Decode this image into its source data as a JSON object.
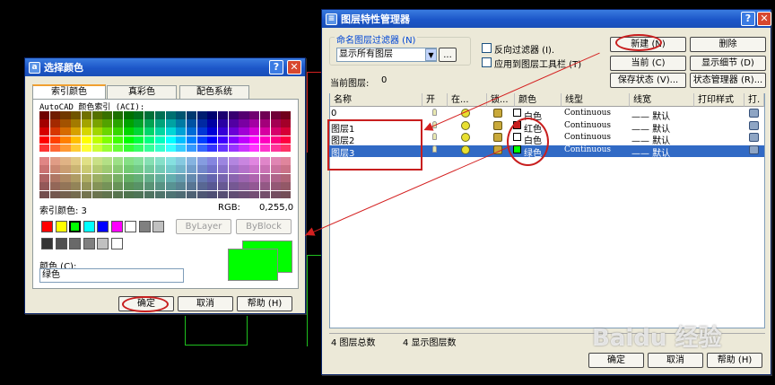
{
  "select_color": {
    "title": "选择颜色",
    "tabs": [
      "索引颜色",
      "真彩色",
      "配色系统"
    ],
    "aci_label": "AutoCAD 颜色索引 (ACI):",
    "index_label": "索引颜色: 3",
    "rgb_label": "RGB:",
    "rgb_value": "0,255,0",
    "bylayer": "ByLayer",
    "byblock": "ByBlock",
    "color_label": "颜色 (C):",
    "color_value": "绿色",
    "ok": "确定",
    "cancel": "取消",
    "help": "帮助 (H)",
    "preview_color": "#00ff00",
    "std_colors": [
      "#ff0000",
      "#ffff00",
      "#00ff00",
      "#00ffff",
      "#0000ff",
      "#ff00ff",
      "#ffffff",
      "#808080",
      "#c0c0c0"
    ],
    "gray_colors": [
      "#333333",
      "#505050",
      "#696969",
      "#808080",
      "#c0c0c0",
      "#ffffff"
    ]
  },
  "layer_manager": {
    "title": "图层特性管理器",
    "filter_label": "命名图层过滤器 (N)",
    "filter_value": "显示所有图层",
    "filter_btn": "...",
    "invert_filter": "反向过滤器 (I).",
    "apply_toolbar": "应用到图层工具栏 (T)",
    "current_layer_label": "当前图层:",
    "current_layer_value": "0",
    "buttons": {
      "new": "新建 (N)",
      "delete": "删除",
      "current": "当前 (C)",
      "details": "显示细节 (D)",
      "save_state": "保存状态 (V)...",
      "state_manager": "状态管理器 (R)..."
    },
    "columns": [
      "名称",
      "开",
      "在...",
      "锁...",
      "颜色",
      "线型",
      "线宽",
      "打印样式",
      "打."
    ],
    "layers": [
      {
        "name": "0",
        "color_name": "白色",
        "color": "#ffffff",
        "linetype": "Continuous",
        "lineweight": "—— 默认"
      },
      {
        "name": "图层1",
        "color_name": "红色",
        "color": "#c81e1e",
        "linetype": "Continuous",
        "lineweight": "—— 默认"
      },
      {
        "name": "图层2",
        "color_name": "白色",
        "color": "#ffffff",
        "linetype": "Continuous",
        "lineweight": "—— 默认"
      },
      {
        "name": "图层3",
        "color_name": "绿色",
        "color": "#00ff00",
        "linetype": "Continuous",
        "lineweight": "—— 默认"
      }
    ],
    "status_total": "4 图层总数",
    "status_shown": "4 显示图层数",
    "ok": "确定",
    "cancel": "取消",
    "help": "帮助 (H)"
  },
  "watermark": "Baidu 经验",
  "colors": {
    "accent_red": "#c81e1e",
    "selection": "#316ac5",
    "title_blue": "#1c56c8"
  }
}
